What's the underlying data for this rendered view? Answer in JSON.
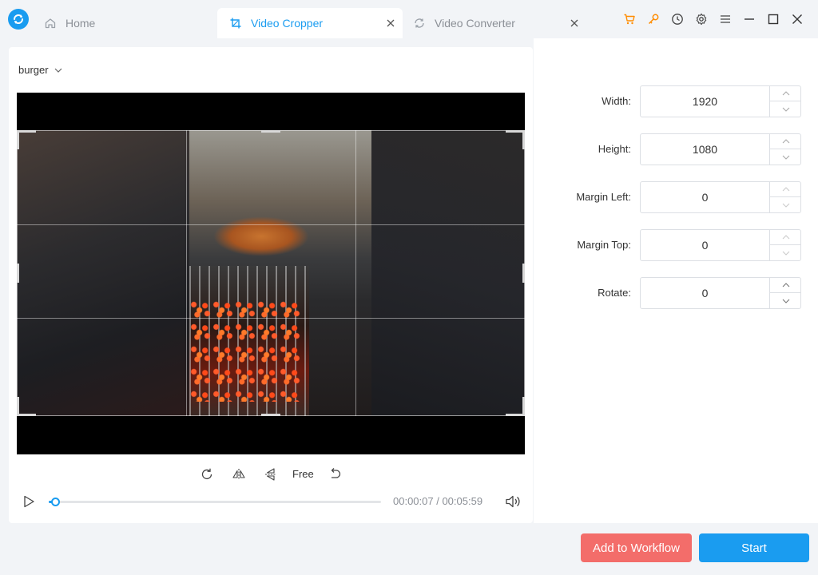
{
  "colors": {
    "accent": "#1a9cf0",
    "workflow_button": "#f36d6a",
    "cart_icon": "#ff8c00",
    "key_icon": "#ff8c00"
  },
  "tabs": [
    {
      "label": "Home",
      "icon": "home-icon",
      "active": false
    },
    {
      "label": "Video Cropper",
      "icon": "crop-icon",
      "active": true
    },
    {
      "label": "Video Converter",
      "icon": "convert-icon",
      "active": false
    }
  ],
  "toolbar_icons": [
    "cart-icon",
    "key-icon",
    "history-icon",
    "gear-icon",
    "menu-icon",
    "minimize-icon",
    "maximize-icon",
    "close-icon"
  ],
  "source": {
    "selected": "burger"
  },
  "tools": {
    "free_label": "Free"
  },
  "player": {
    "time": "00:00:07 / 00:05:59",
    "progress_fraction": 0.02
  },
  "settings": [
    {
      "label": "Width:",
      "value": "1920"
    },
    {
      "label": "Height:",
      "value": "1080"
    },
    {
      "label": "Margin Left:",
      "value": "0"
    },
    {
      "label": "Margin Top:",
      "value": "0"
    },
    {
      "label": "Rotate:",
      "value": "0"
    }
  ],
  "buttons": {
    "workflow": "Add to Workflow",
    "start": "Start"
  }
}
